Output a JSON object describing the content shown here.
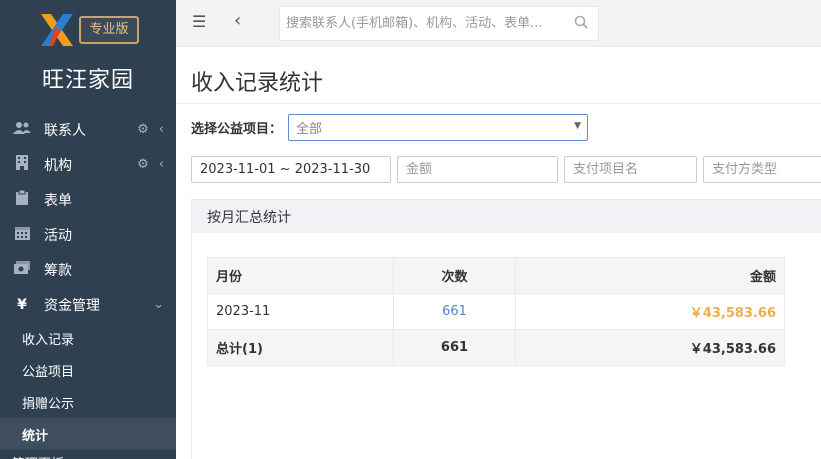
{
  "app": {
    "logo_badge": "专业版",
    "org_name": "旺汪家园"
  },
  "sidebar": {
    "items": [
      {
        "label": "联系人",
        "icon": "contacts-icon"
      },
      {
        "label": "机构",
        "icon": "building-icon"
      },
      {
        "label": "表单",
        "icon": "clipboard-icon"
      },
      {
        "label": "活动",
        "icon": "calendar-icon"
      },
      {
        "label": "筹款",
        "icon": "money-icon"
      },
      {
        "label": "资金管理",
        "icon": "yuan-icon"
      }
    ],
    "yuan_glyph": "¥",
    "sub_items": [
      {
        "label": "收入记录"
      },
      {
        "label": "公益项目"
      },
      {
        "label": "捐赠公示"
      },
      {
        "label": "统计"
      }
    ],
    "cut_item": "管理面板"
  },
  "topbar": {
    "search_placeholder": "搜索联系人(手机邮箱)、机构、活动、表单..."
  },
  "page": {
    "title": "收入记录统计",
    "project_label": "选择公益项目：",
    "project_selected": "全部",
    "date_range_value": "2023-11-01 ~ 2023-11-30",
    "amount_placeholder": "金额",
    "pay_item_placeholder": "支付项目名",
    "pay_type_placeholder": "支付方类型"
  },
  "panel": {
    "title": "按月汇总统计",
    "table": {
      "headers": {
        "month": "月份",
        "count": "次数",
        "amount": "金额"
      },
      "rows": [
        {
          "month": "2023-11",
          "count": "661",
          "amount": "￥43,583.66"
        }
      ],
      "total": {
        "label": "总计(1)",
        "count": "661",
        "amount": "￥43,583.66"
      }
    }
  },
  "colors": {
    "sidebar_bg": "#2f4050",
    "accent_blue": "#4a8bc9",
    "amount_orange": "#f0ad4e",
    "badge_gold": "#c8a46b"
  }
}
